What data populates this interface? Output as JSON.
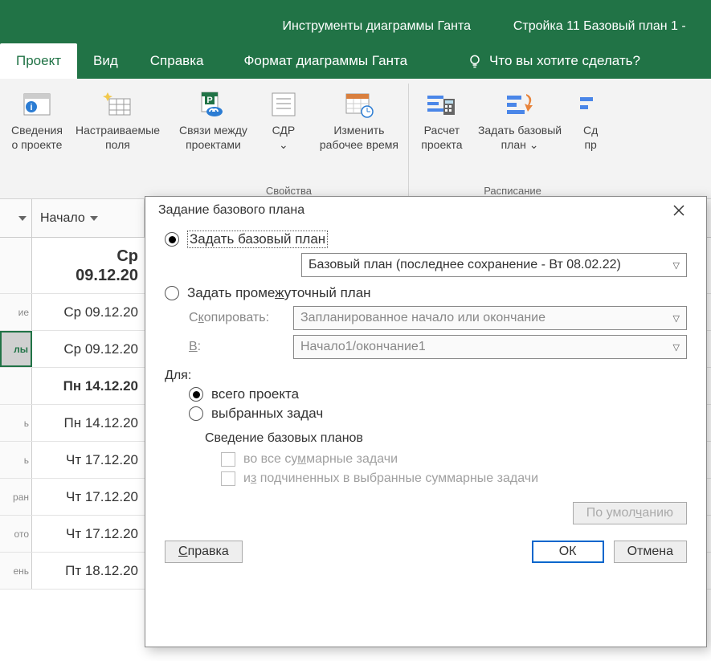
{
  "title": {
    "context": "Инструменты диаграммы Ганта",
    "filename": "Стройка 11 Базовый план 1 -"
  },
  "tabs": {
    "project": "Проект",
    "view": "Вид",
    "help": "Справка",
    "format": "Формат диаграммы Ганта",
    "tellme": "Что вы хотите сделать?"
  },
  "ribbon": {
    "info": {
      "l1": "Сведения",
      "l2": "о проекте"
    },
    "custom": {
      "l1": "Настраиваемые",
      "l2": "поля"
    },
    "links": {
      "l1": "Связи между",
      "l2": "проектами"
    },
    "wbs": {
      "l1": "СДР",
      "l2": ""
    },
    "worktime": {
      "l1": "Изменить",
      "l2": "рабочее время"
    },
    "calc": {
      "l1": "Расчет",
      "l2": "проекта"
    },
    "baseline": {
      "l1": "Задать базовый",
      "l2": "план ⌄"
    },
    "move": {
      "l1": "Сд",
      "l2": "пр"
    },
    "group_props": "Свойства",
    "group_schedule": "Расписание"
  },
  "grid": {
    "header_start": "Начало",
    "rows": [
      {
        "stub": "",
        "date": "Ср 09.12.20",
        "bold": true,
        "twoLine": true,
        "line1": "Ср",
        "line2": "09.12.20"
      },
      {
        "stub": "ие",
        "date": "Ср 09.12.20"
      },
      {
        "stub": "лы",
        "date": "Ср 09.12.20",
        "sel": true
      },
      {
        "stub": "",
        "date": "Пн 14.12.20",
        "bold": true
      },
      {
        "stub": "ь",
        "date": "Пн 14.12.20"
      },
      {
        "stub": "ь",
        "date": "Чт 17.12.20"
      },
      {
        "stub": "ран",
        "date": "Чт 17.12.20"
      },
      {
        "stub": "ото",
        "date": "Чт 17.12.20"
      },
      {
        "stub": "ень",
        "date": "Пт 18.12.20"
      }
    ]
  },
  "dialog": {
    "title": "Задание базового плана",
    "opt_baseline": "Задать базовый план",
    "baseline_combo": "Базовый план (последнее сохранение - Вт 08.02.22)",
    "opt_interim_pre": "Задать проме",
    "opt_interim_ul": "ж",
    "opt_interim_post": "уточный план",
    "copy_label_pre": "С",
    "copy_label_ul": "к",
    "copy_label_post": "опировать:",
    "copy_value": "Запланированное начало или окончание",
    "to_label": "В",
    "to_value": "Начало1/окончание1",
    "for_label": "Для:",
    "for_all": "всего проекта",
    "for_sel": "выбранных задач",
    "rollup_title": "Сведение базовых планов",
    "rollup_1_pre": "во все су",
    "rollup_1_ul": "м",
    "rollup_1_post": "марные задачи",
    "rollup_2_pre": "и",
    "rollup_2_ul": "з",
    "rollup_2_post": " подчиненных в выбранные суммарные задачи",
    "default_btn_pre": "По умол",
    "default_btn_ul": "ч",
    "default_btn_post": "анию",
    "help_btn_ul": "С",
    "help_btn_post": "правка",
    "ok": "ОК",
    "cancel": "Отмена"
  }
}
